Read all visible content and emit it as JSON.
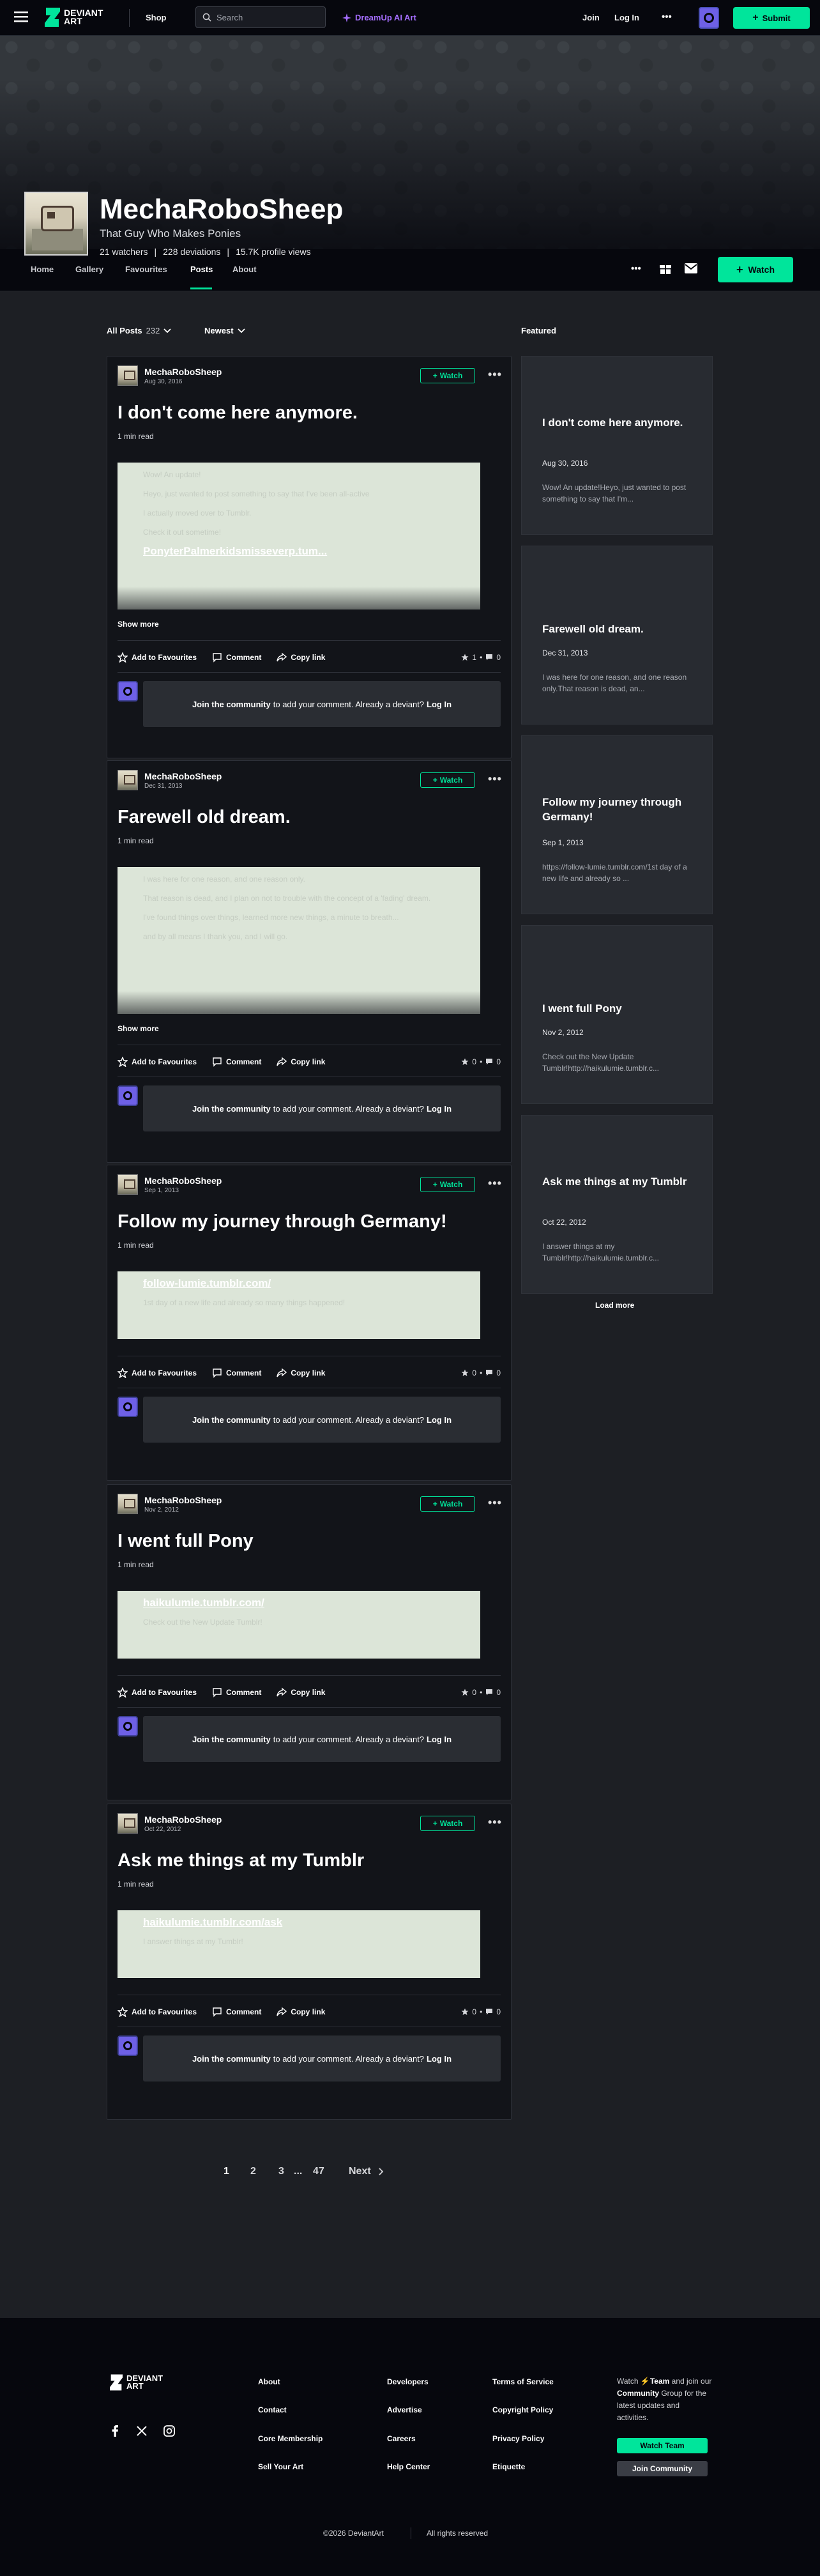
{
  "topbar": {
    "logo_line1": "DEVIANT",
    "logo_line2": "ART",
    "shop": "Shop",
    "search_placeholder": "Search",
    "dreamup": "DreamUp AI Art",
    "join": "Join",
    "login": "Log In",
    "more": "•••",
    "submit": "Submit"
  },
  "profile": {
    "username": "MechaRoboSheep",
    "tagline": "That Guy Who Makes Ponies",
    "watchers": "21 watchers",
    "deviations": "228 deviations",
    "views": "15.7K profile views",
    "sep": "|"
  },
  "tabs": [
    {
      "label": "Home"
    },
    {
      "label": "Gallery"
    },
    {
      "label": "Favourites"
    },
    {
      "label": "Posts"
    },
    {
      "label": "About"
    }
  ],
  "tab_actions": {
    "more": "•••",
    "watch": "Watch"
  },
  "filters": {
    "all_posts": "All Posts",
    "count": "232",
    "sort": "Newest",
    "featured": "Featured"
  },
  "post_common": {
    "author": "MechaRoboSheep",
    "watch": "Watch",
    "menu": "•••",
    "read_time": "1 min read",
    "show_more": "Show more",
    "add_fav": "Add to Favourites",
    "comment": "Comment",
    "copy_link": "Copy link",
    "dot": "•",
    "join_community": "Join the community",
    "comment_prompt": "to add your comment. Already a deviant?",
    "login": "Log In"
  },
  "posts": [
    {
      "date": "Aug 30, 2016",
      "title": "I don't come here anymore.",
      "lines": [
        "Wow! An update!",
        "Heyo, just wanted to post something to say that I've been all-active",
        "I actually moved over to Tumblr.",
        "Check it out sometime!"
      ],
      "link": "PonyterPalmerkidsmisseverp.tum...",
      "favs": "1",
      "comments": "0"
    },
    {
      "date": "Dec 31, 2013",
      "title": "Farewell old dream.",
      "lines": [
        "I was here for one reason, and one reason only.",
        "That reason is dead, and I plan on not to trouble with the concept of a 'fading' dream.",
        "I've found things over things, learned more new things, a minute to breath...",
        "and by all means I thank you, and I will go."
      ],
      "link": "",
      "favs": "0",
      "comments": "0"
    },
    {
      "date": "Sep 1, 2013",
      "title": "Follow my journey through Germany!",
      "lines": [
        "1st day of a new life and already so many things happened!"
      ],
      "link": "follow-lumie.tumblr.com/",
      "favs": "0",
      "comments": "0"
    },
    {
      "date": "Nov 2, 2012",
      "title": "I went full Pony",
      "lines": [
        "Check out the New Update Tumblr!"
      ],
      "link": "haikulumie.tumblr.com/",
      "favs": "0",
      "comments": "0"
    },
    {
      "date": "Oct 22, 2012",
      "title": "Ask me things at my Tumblr",
      "lines": [
        "I answer things at my Tumblr!"
      ],
      "link": "haikulumie.tumblr.com/ask",
      "favs": "0",
      "comments": "0"
    }
  ],
  "featured": [
    {
      "title": "I don't come here anymore.",
      "date": "Aug 30, 2016",
      "desc": "Wow! An update!Heyo, just wanted to post something to say that I'm..."
    },
    {
      "title": "Farewell old dream.",
      "date": "Dec 31, 2013",
      "desc": "I was here for one reason, and one reason only.That reason is dead, an..."
    },
    {
      "title": "Follow my journey through Germany!",
      "date": "Sep 1, 2013",
      "desc": "https://follow-lumie.tumblr.com/1st day of a new life and already so ..."
    },
    {
      "title": "I went full Pony",
      "date": "Nov 2, 2012",
      "desc": "Check out the New Update Tumblr!http://haikulumie.tumblr.c..."
    },
    {
      "title": "Ask me things at my Tumblr",
      "date": "Oct 22, 2012",
      "desc": "I answer things at my Tumblr!http://haikulumie.tumblr.c..."
    }
  ],
  "load_more": "Load more",
  "pagination": {
    "p1": "1",
    "p2": "2",
    "p3": "3",
    "ellipsis": "...",
    "last": "47",
    "next": "Next"
  },
  "footer": {
    "col1": [
      "About",
      "Contact",
      "Core Membership",
      "Sell Your Art"
    ],
    "col2": [
      "Developers",
      "Advertise",
      "Careers",
      "Help Center"
    ],
    "col3": [
      "Terms of Service",
      "Copyright Policy",
      "Privacy Policy",
      "Etiquette"
    ],
    "promo_watch": "Watch",
    "promo_team": "Team",
    "promo_and_join": "and join our",
    "promo_community": "Community",
    "promo_rest": "Group for the latest updates and activities.",
    "watch_team": "Watch Team",
    "join_community": "Join Community",
    "copyright": "©2026 DeviantArt",
    "rights": "All rights reserved"
  },
  "colors": {
    "accent": "#00e59b",
    "bg": "#06070d",
    "panel": "#121419",
    "dreamup": "#a56eff"
  }
}
